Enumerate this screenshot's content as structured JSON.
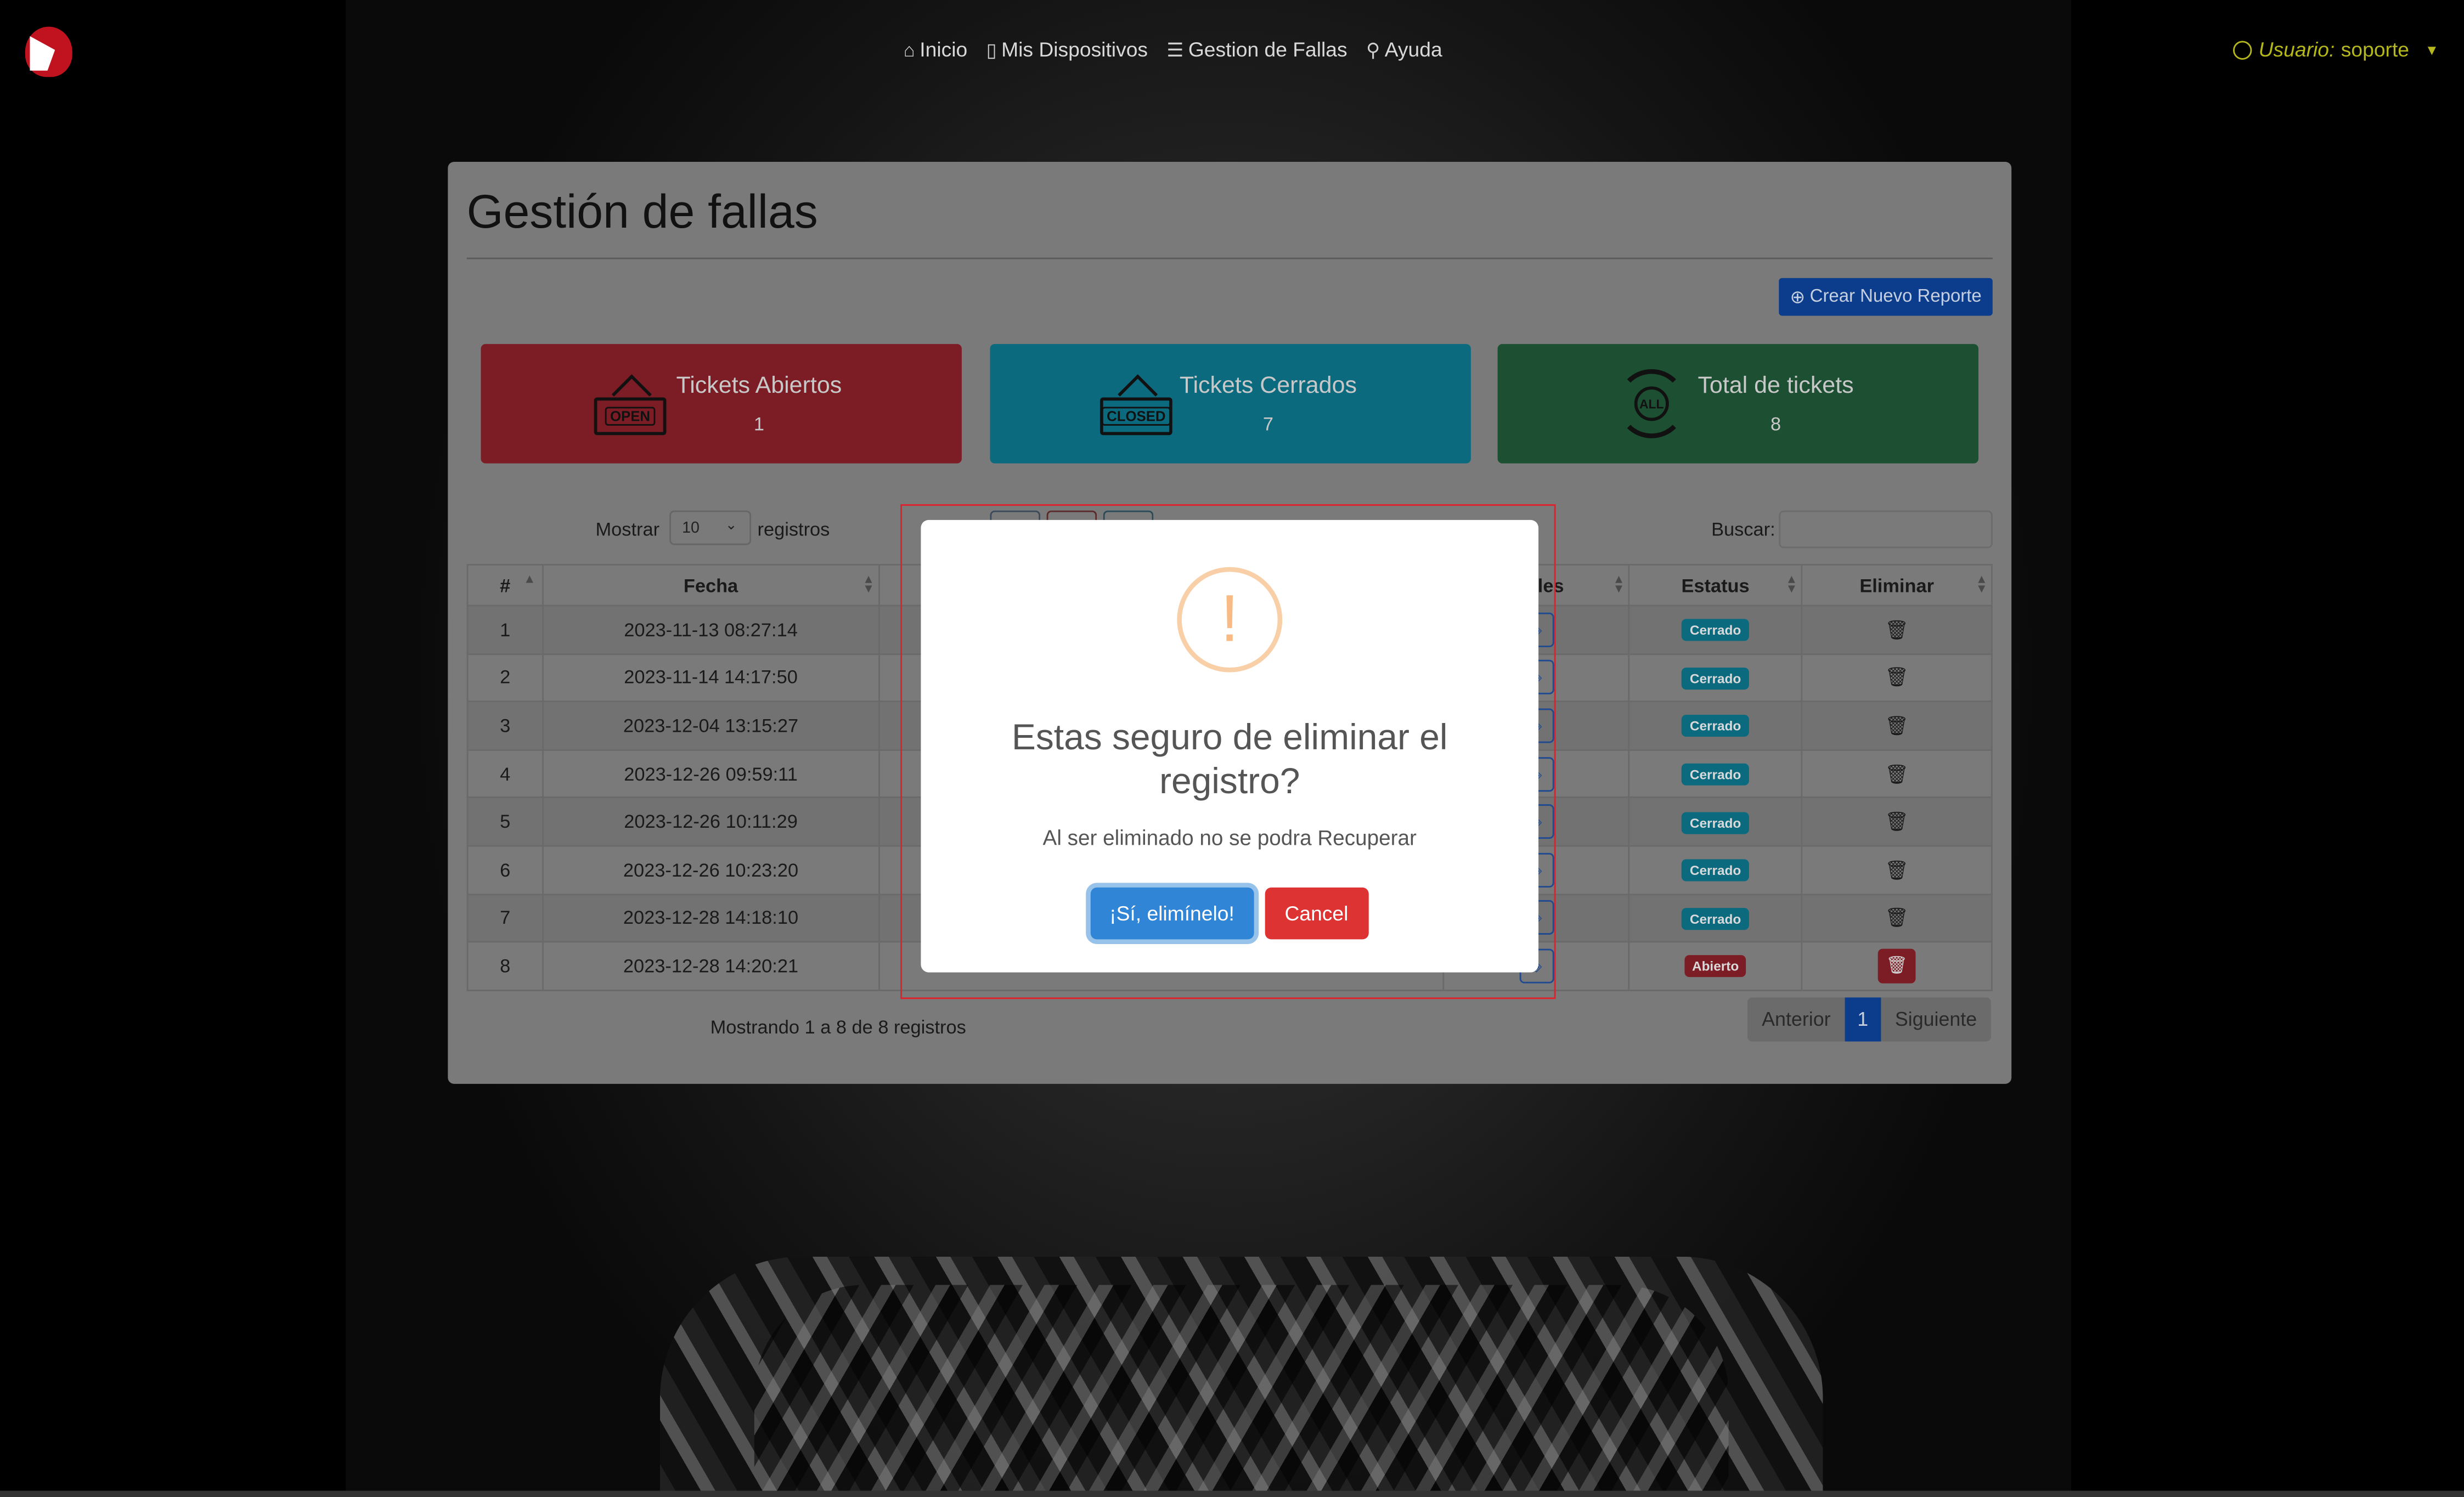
{
  "nav": {
    "links": [
      {
        "label": "Inicio",
        "icon": "house-icon"
      },
      {
        "label": "Mis Dispositivos",
        "icon": "devices-icon"
      },
      {
        "label": "Gestion de Fallas",
        "icon": "list-icon"
      },
      {
        "label": "Ayuda",
        "icon": "help-icon"
      }
    ],
    "user_prefix": "Usuario:",
    "user_name": "soporte"
  },
  "page": {
    "title": "Gestión de fallas",
    "create_button": "Crear Nuevo Reporte"
  },
  "stats": [
    {
      "title": "Tickets Abiertos",
      "count": "1",
      "sign": "OPEN",
      "color": "#7c1c25"
    },
    {
      "title": "Tickets Cerrados",
      "count": "7",
      "sign": "CLOSED",
      "color": "#0c6a7f"
    },
    {
      "title": "Total de tickets",
      "count": "8",
      "sign": "ALL",
      "color": "#1d4f32"
    }
  ],
  "table_controls": {
    "show_label": "Mostrar",
    "page_length": "10",
    "records_label": "registros",
    "search_label": "Buscar:"
  },
  "table": {
    "columns": [
      "#",
      "Fecha",
      "lles",
      "Estatus",
      "Eliminar"
    ],
    "rows": [
      {
        "id": "1",
        "fecha": "2023-11-13 08:27:14",
        "estatus": "Cerrado"
      },
      {
        "id": "2",
        "fecha": "2023-11-14 14:17:50",
        "estatus": "Cerrado"
      },
      {
        "id": "3",
        "fecha": "2023-12-04 13:15:27",
        "estatus": "Cerrado"
      },
      {
        "id": "4",
        "fecha": "2023-12-26 09:59:11",
        "estatus": "Cerrado"
      },
      {
        "id": "5",
        "fecha": "2023-12-26 10:11:29",
        "estatus": "Cerrado"
      },
      {
        "id": "6",
        "fecha": "2023-12-26 10:23:20",
        "estatus": "Cerrado"
      },
      {
        "id": "7",
        "fecha": "2023-12-28 14:18:10",
        "estatus": "Cerrado"
      },
      {
        "id": "8",
        "fecha": "2023-12-28 14:20:21",
        "estatus": "Abierto"
      }
    ],
    "info": "Mostrando 1 a 8 de 8 registros",
    "pagination": {
      "prev": "Anterior",
      "current": "1",
      "next": "Siguiente"
    }
  },
  "modal": {
    "icon": "!",
    "title": "Estas seguro de eliminar el registro?",
    "text": "Al ser eliminado no se podra Recuperar",
    "confirm": "¡Sí, elimínelo!",
    "cancel": "Cancel"
  },
  "colors": {
    "confirm": "#3085d6",
    "cancel": "#dd3333",
    "closed_badge": "#0c6a7f",
    "open_badge": "#7c1c25",
    "user_accent": "#b5b81c"
  }
}
